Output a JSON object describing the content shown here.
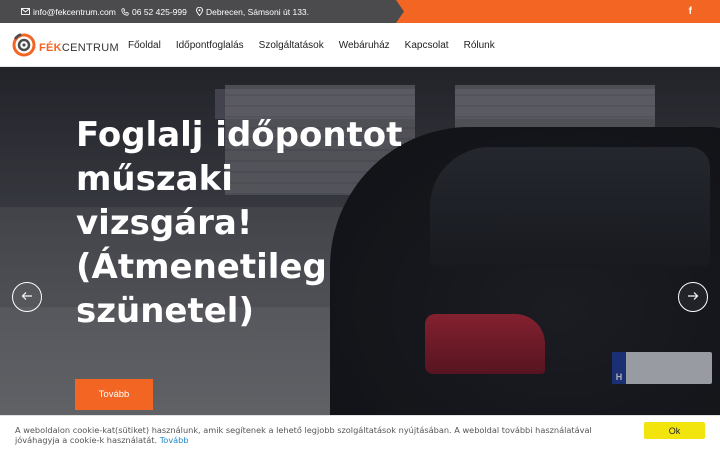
{
  "topbar": {
    "email": "info@fekcentrum.com",
    "email_icon": "envelope-icon",
    "phone": "06 52 425-999",
    "phone_icon": "phone-icon",
    "address": "Debrecen, Sámsoni út 133.",
    "address_icon": "location-pin-icon",
    "social_icon": "facebook-icon",
    "social_label": "f",
    "accent_color": "#f26522",
    "bg_color": "#4b4b4d"
  },
  "logo": {
    "brand_highlight": "FÉK",
    "brand_rest": "CENTRUM",
    "icon": "brake-disc-logo-icon"
  },
  "nav": {
    "items": [
      "Főoldal",
      "Időpontfoglalás",
      "Szolgáltatások",
      "Webáruház",
      "Kapcsolat",
      "Rólunk"
    ]
  },
  "hero": {
    "headline": "Foglalj időpontot műszaki vizsgára! (Átmenetileg szünetel)",
    "cta_label": "Tovább",
    "prev_icon": "arrow-left-icon",
    "next_icon": "arrow-right-icon",
    "plate_country": "H"
  },
  "cookie": {
    "text": "A weboldalon cookie-kat(sütiket) használunk, amik segítenek a lehető legjobb szolgáltatások nyújtásában. A weboldal további használatával jóváhagyja a cookie-k használatát.",
    "link_label": "Tovább",
    "ok_label": "Ok",
    "ok_color": "#f2e50d"
  }
}
